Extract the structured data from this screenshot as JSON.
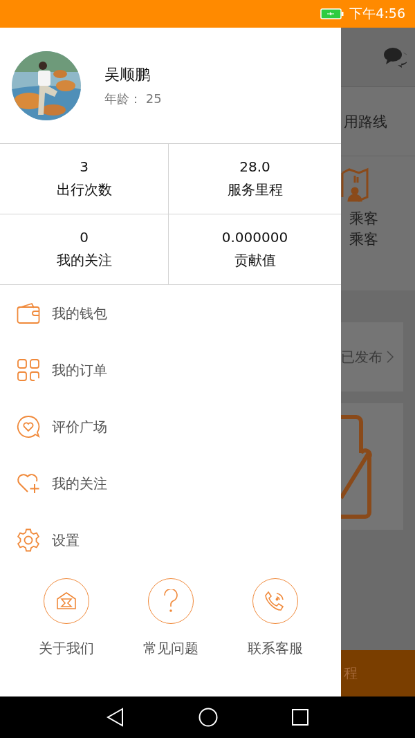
{
  "status_bar": {
    "time": "下午4:56"
  },
  "background_app": {
    "route_label": "用路线",
    "passenger_lines": [
      "乘客",
      "乘客"
    ],
    "published_label": "已发布",
    "bottom_button": "程"
  },
  "drawer": {
    "profile": {
      "name": "吴顺鹏",
      "age": "年龄： 25"
    },
    "stats": [
      {
        "value": "3",
        "label": "出行次数"
      },
      {
        "value": "28.0",
        "label": "服务里程"
      },
      {
        "value": "0",
        "label": "我的关注"
      },
      {
        "value": "0.000000",
        "label": "贡献值"
      }
    ],
    "menu": [
      {
        "kind": "wallet",
        "label": "我的钱包"
      },
      {
        "kind": "orders",
        "label": "我的订单"
      },
      {
        "kind": "reviews",
        "label": "评价广场"
      },
      {
        "kind": "follow",
        "label": "我的关注"
      },
      {
        "kind": "settings",
        "label": "设置"
      }
    ],
    "footer": [
      {
        "kind": "about",
        "label": "关于我们"
      },
      {
        "kind": "faq",
        "label": "常见问题"
      },
      {
        "kind": "contact",
        "label": "联系客服"
      }
    ]
  }
}
